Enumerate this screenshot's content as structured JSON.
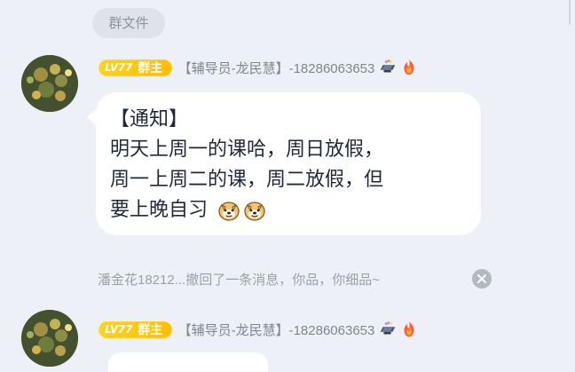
{
  "top_chip": {
    "label": "群文件"
  },
  "messages": [
    {
      "level": "LV77",
      "role": "群主",
      "sender": "【辅导员-龙民慧】-18286063653",
      "lines": [
        "【通知】",
        "明天上周一的课哈，周日放假，",
        "周一上周二的课，周二放假，但",
        "要上晚自习"
      ]
    },
    {
      "level": "LV77",
      "role": "群主",
      "sender": "【辅导员-龙民慧】-18286063653"
    }
  ],
  "system_notice": {
    "text": "潘金花18212...撤回了一条消息，你品，你细品~"
  },
  "icons": {
    "badge_1": "diamond-gift-icon",
    "badge_2": "flame-icon",
    "emoji_1": "doge-emoji-icon",
    "emoji_2": "doge-emoji-icon",
    "dismiss": "close-circle-icon"
  },
  "colors": {
    "background": "#eef0f7",
    "bubble": "#ffffff",
    "owner_badge": "#ffbe00",
    "secondary_text": "#7f8591"
  }
}
